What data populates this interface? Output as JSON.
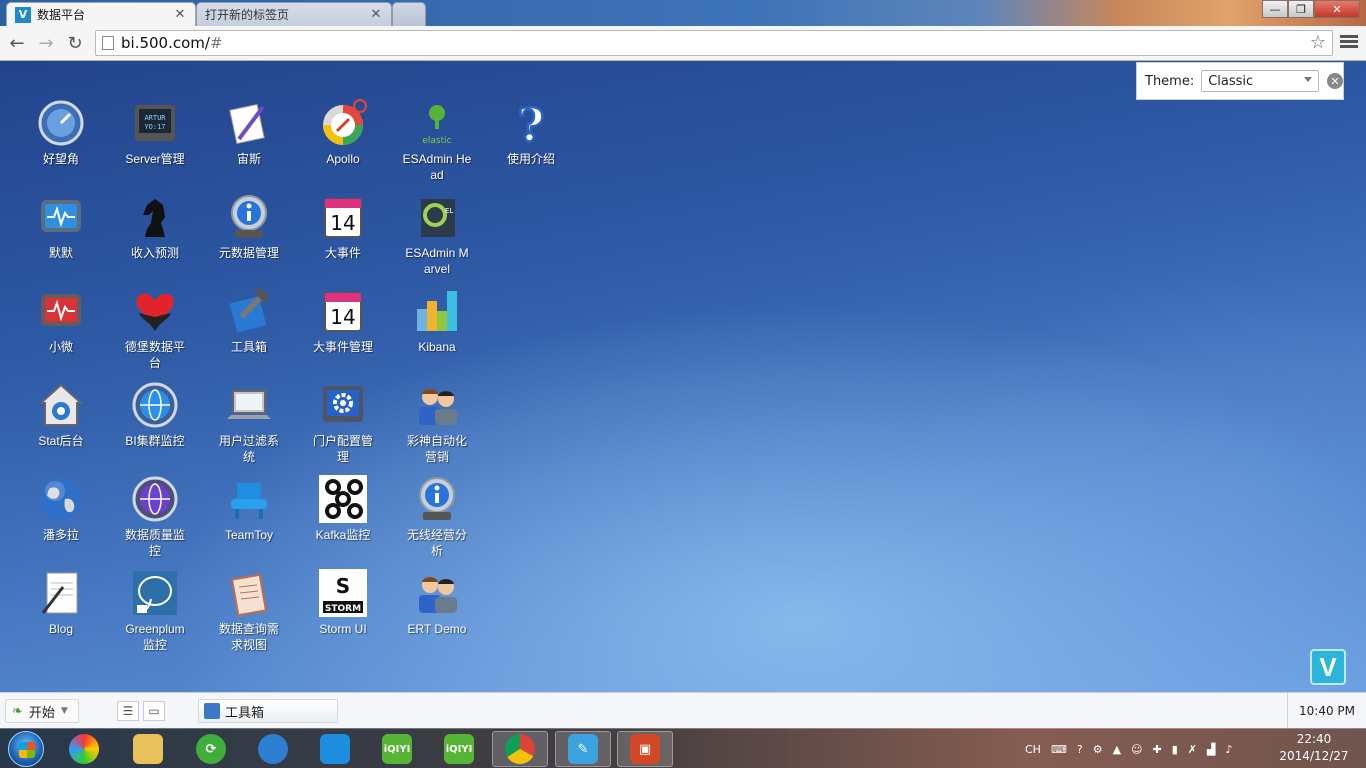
{
  "browser": {
    "tabs": [
      {
        "title": "数据平台",
        "favicon": "V"
      },
      {
        "title": "打开新的标签页"
      }
    ],
    "url_host": "bi.500.com/",
    "url_path": "#"
  },
  "theme": {
    "label": "Theme:",
    "value": "Classic"
  },
  "apps": [
    {
      "label": "好望角",
      "icon": "gauge-icon"
    },
    {
      "label": "Server管理",
      "icon": "server-display-icon"
    },
    {
      "label": "宙斯",
      "icon": "pen-paper-icon"
    },
    {
      "label": "Apollo",
      "icon": "compass-icon"
    },
    {
      "label": "ESAdmin Head",
      "icon": "elasticsearch-icon"
    },
    {
      "label": "使用介绍",
      "icon": "question-icon"
    },
    {
      "label": "默默",
      "icon": "monitor-pulse-icon"
    },
    {
      "label": "收入预测",
      "icon": "chess-knight-icon"
    },
    {
      "label": "元数据管理",
      "icon": "info-icon"
    },
    {
      "label": "大事件",
      "icon": "calendar-icon"
    },
    {
      "label": "ESAdmin Marvel",
      "icon": "marvel-icon"
    },
    {
      "label": "小微",
      "icon": "monitor-red-icon"
    },
    {
      "label": "德堡数据平台",
      "icon": "hearts-icon"
    },
    {
      "label": "工具箱",
      "icon": "toolbox-icon"
    },
    {
      "label": "大事件管理",
      "icon": "calendar-icon"
    },
    {
      "label": "Kibana",
      "icon": "kibana-icon"
    },
    {
      "label": "Stat后台",
      "icon": "home-icon"
    },
    {
      "label": "BI集群监控",
      "icon": "globe-blue-icon"
    },
    {
      "label": "用户过滤系统",
      "icon": "laptop-icon"
    },
    {
      "label": "门户配置管理",
      "icon": "gear-screen-icon"
    },
    {
      "label": "彩神自动化营销",
      "icon": "users-icon"
    },
    {
      "label": "潘多拉",
      "icon": "earth-icon"
    },
    {
      "label": "数据质量监控",
      "icon": "globe-purple-icon"
    },
    {
      "label": "TeamToy",
      "icon": "chair-icon"
    },
    {
      "label": "Kafka监控",
      "icon": "kafka-icon"
    },
    {
      "label": "无线经营分析",
      "icon": "info-icon"
    },
    {
      "label": "Blog",
      "icon": "notes-icon"
    },
    {
      "label": "Greenplum监控",
      "icon": "elephant-icon"
    },
    {
      "label": "数据查询需求视图",
      "icon": "clipboard-icon"
    },
    {
      "label": "Storm UI",
      "icon": "storm-icon"
    },
    {
      "label": "ERT Demo",
      "icon": "users-icon"
    }
  ],
  "webbar": {
    "start_label": "开始",
    "task_label": "工具箱",
    "clock": "10:40 PM"
  },
  "windows_tray": {
    "lang": "CH",
    "time": "22:40",
    "date": "2014/12/27"
  }
}
